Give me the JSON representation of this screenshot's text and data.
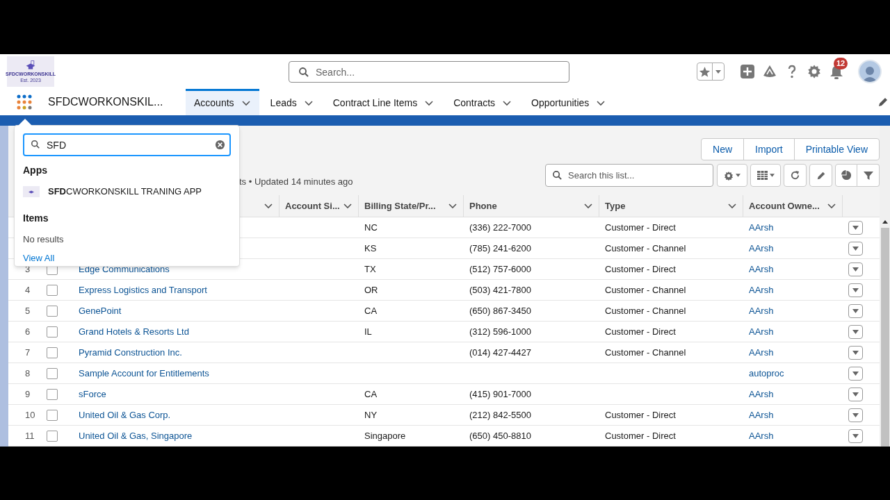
{
  "logo": {
    "name": "SFDCWORKONSKILL",
    "year": "Est. 2023"
  },
  "global_search": {
    "placeholder": "Search..."
  },
  "notifications": {
    "count": "12"
  },
  "app_name": "SFDCWORKONSKIL...",
  "tabs": [
    {
      "label": "Accounts",
      "selected": true
    },
    {
      "label": "Leads",
      "selected": false
    },
    {
      "label": "Contract Line Items",
      "selected": false
    },
    {
      "label": "Contracts",
      "selected": false
    },
    {
      "label": "Opportunities",
      "selected": false
    }
  ],
  "list": {
    "status": "ts • Updated 14 minutes ago",
    "actions": [
      "New",
      "Import",
      "Printable View"
    ],
    "search": {
      "placeholder": "Search this list..."
    },
    "columns": [
      "Account Si...",
      "Billing State/Pr...",
      "Phone",
      "Type",
      "Account Owne..."
    ],
    "rows": [
      {
        "billing_state": "NC",
        "phone": "(336) 222-7000",
        "type": "Customer - Direct",
        "owner": "AArsh"
      },
      {
        "billing_state": "KS",
        "phone": "(785) 241-6200",
        "type": "Customer - Channel",
        "owner": "AArsh"
      },
      {
        "number": "3",
        "checked": false,
        "name": "Edge Communications",
        "billing_state": "TX",
        "phone": "(512) 757-6000",
        "type": "Customer - Direct",
        "owner": "AArsh"
      },
      {
        "number": "4",
        "checked": false,
        "name": "Express Logistics and Transport",
        "billing_state": "OR",
        "phone": "(503) 421-7800",
        "type": "Customer - Channel",
        "owner": "AArsh"
      },
      {
        "number": "5",
        "checked": false,
        "name": "GenePoint",
        "billing_state": "CA",
        "phone": "(650) 867-3450",
        "type": "Customer - Channel",
        "owner": "AArsh"
      },
      {
        "number": "6",
        "checked": false,
        "name": "Grand Hotels & Resorts Ltd",
        "billing_state": "IL",
        "phone": "(312) 596-1000",
        "type": "Customer - Direct",
        "owner": "AArsh"
      },
      {
        "number": "7",
        "checked": false,
        "name": "Pyramid Construction Inc.",
        "phone": "(014) 427-4427",
        "type": "Customer - Channel",
        "owner": "AArsh"
      },
      {
        "number": "8",
        "checked": false,
        "name": "Sample Account for Entitlements",
        "owner": "autoproc"
      },
      {
        "number": "9",
        "checked": false,
        "name": "sForce",
        "billing_state": "CA",
        "phone": "(415) 901-7000",
        "owner": "AArsh"
      },
      {
        "number": "10",
        "checked": false,
        "name": "United Oil & Gas Corp.",
        "billing_state": "NY",
        "phone": "(212) 842-5500",
        "type": "Customer - Direct",
        "owner": "AArsh"
      },
      {
        "number": "11",
        "checked": false,
        "name": "United Oil & Gas, Singapore",
        "billing_state": "Singapore",
        "phone": "(650) 450-8810",
        "type": "Customer - Direct",
        "owner": "AArsh"
      }
    ]
  },
  "app_launcher": {
    "search": {
      "value": "SFD"
    },
    "apps_heading": "Apps",
    "apps": [
      {
        "label": "**SFD**CWORKONSKILL TRANING APP"
      }
    ],
    "items_heading": "Items",
    "no_results": "No results",
    "view_all": "View All"
  }
}
